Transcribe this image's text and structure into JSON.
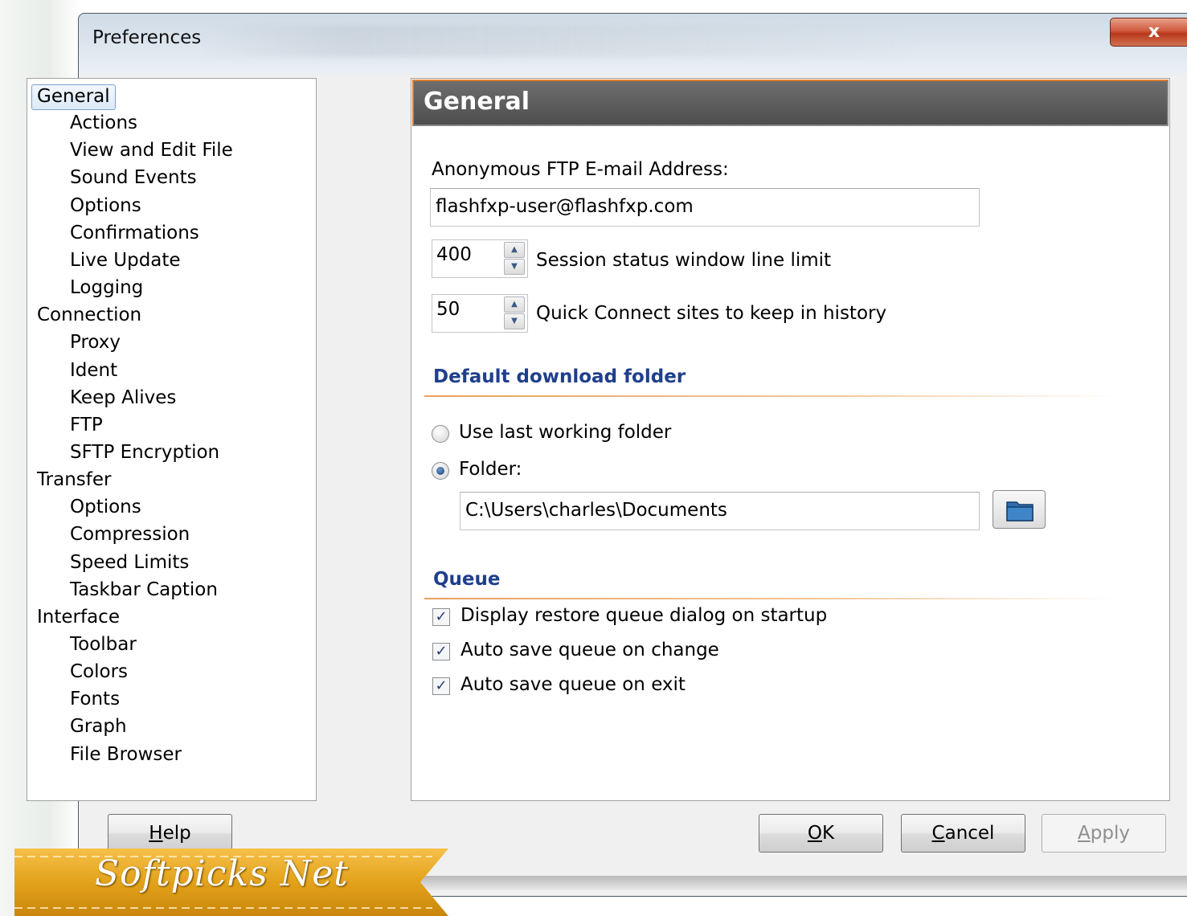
{
  "window": {
    "title": "Preferences",
    "close_label": "x"
  },
  "tree": [
    {
      "label": "General",
      "level": 0,
      "selected": true
    },
    {
      "label": "Actions",
      "level": 1
    },
    {
      "label": "View and Edit File",
      "level": 1
    },
    {
      "label": "Sound Events",
      "level": 1
    },
    {
      "label": "Options",
      "level": 1
    },
    {
      "label": "Confirmations",
      "level": 1
    },
    {
      "label": "Live Update",
      "level": 1
    },
    {
      "label": "Logging",
      "level": 1
    },
    {
      "label": "Connection",
      "level": 0
    },
    {
      "label": "Proxy",
      "level": 1
    },
    {
      "label": "Ident",
      "level": 1
    },
    {
      "label": "Keep Alives",
      "level": 1
    },
    {
      "label": "FTP",
      "level": 1
    },
    {
      "label": "SFTP Encryption",
      "level": 1
    },
    {
      "label": "Transfer",
      "level": 0
    },
    {
      "label": "Options",
      "level": 1
    },
    {
      "label": "Compression",
      "level": 1
    },
    {
      "label": "Speed Limits",
      "level": 1
    },
    {
      "label": "Taskbar Caption",
      "level": 1
    },
    {
      "label": "Interface",
      "level": 0
    },
    {
      "label": "Toolbar",
      "level": 1
    },
    {
      "label": "Colors",
      "level": 1
    },
    {
      "label": "Fonts",
      "level": 1
    },
    {
      "label": "Graph",
      "level": 1
    },
    {
      "label": "File Browser",
      "level": 1
    }
  ],
  "general": {
    "header": "General",
    "email_label": "Anonymous FTP E-mail Address:",
    "email_value": "flashfxp-user@flashfxp.com",
    "session_limit_value": "400",
    "session_limit_label": "Session status window line limit",
    "quick_connect_value": "50",
    "quick_connect_label": "Quick Connect sites to keep in history"
  },
  "download": {
    "section_title": "Default download folder",
    "option_last": "Use last working folder",
    "option_folder": "Folder:",
    "selected_option": "folder",
    "folder_path": "C:\\Users\\charles\\Documents"
  },
  "queue": {
    "section_title": "Queue",
    "options": [
      {
        "label": "Display restore queue dialog on startup",
        "checked": true
      },
      {
        "label": "Auto save queue on change",
        "checked": true
      },
      {
        "label": "Auto save queue on exit",
        "checked": true
      }
    ]
  },
  "buttons": {
    "help": {
      "label": "Help",
      "mnemonic": "H"
    },
    "ok": {
      "label": "OK",
      "mnemonic": "O"
    },
    "cancel": {
      "label": "Cancel",
      "mnemonic": "C"
    },
    "apply": {
      "label": "Apply",
      "mnemonic": "A",
      "enabled": false
    }
  },
  "watermark": "Softpicks Net",
  "colors": {
    "section_title": "#1f3f8c",
    "header_bg": "#5a5a5a",
    "header_accent": "#e07e2c",
    "ribbon": "#e3a21a"
  }
}
